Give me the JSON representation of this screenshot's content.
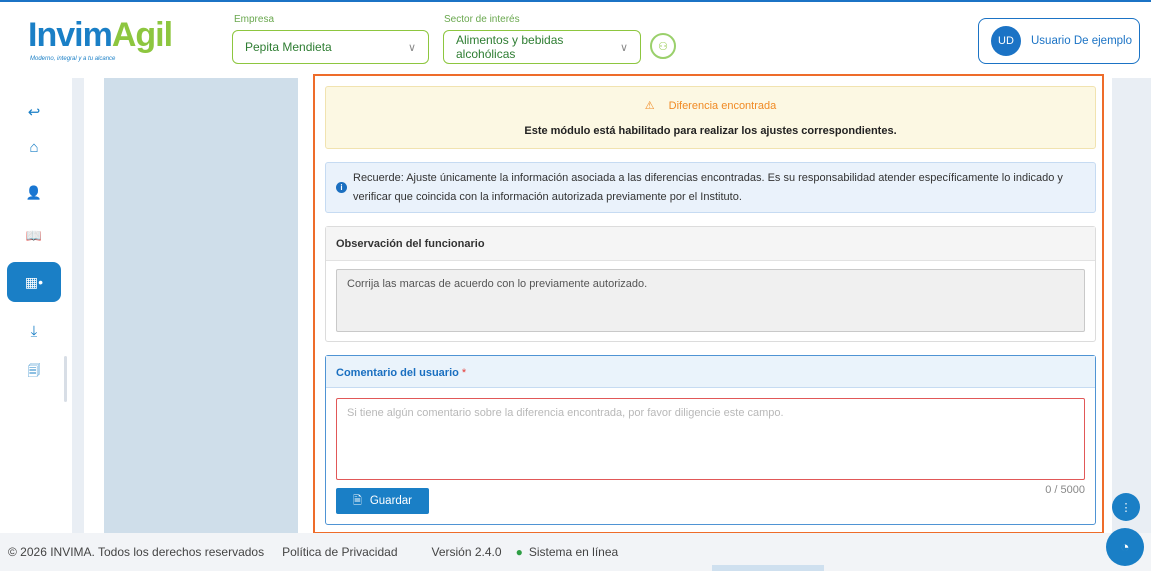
{
  "header": {
    "logo": {
      "text_a": "In",
      "text_b": "vim",
      "text_c": "Agil",
      "tagline": "Moderno, integral y a tu alcance"
    },
    "empresa": {
      "label": "Empresa",
      "value": "Pepita Mendieta"
    },
    "sector": {
      "label": "Sector de interés",
      "value": "Alimentos y bebidas alcohólicas"
    },
    "user": {
      "initials": "UD",
      "name": "Usuario De ejemplo"
    }
  },
  "sidebar": {
    "items": [
      {
        "icon": "back-arrow-icon",
        "glyph": "↩"
      },
      {
        "icon": "home-icon",
        "glyph": "⌂"
      },
      {
        "icon": "user-icon",
        "glyph": "👤"
      },
      {
        "icon": "book-icon",
        "glyph": "📖"
      },
      {
        "icon": "grid-icon",
        "glyph": "▦•"
      },
      {
        "icon": "download-doc-icon",
        "glyph": "⤓"
      },
      {
        "icon": "documents-icon",
        "glyph": "🗐"
      }
    ]
  },
  "alert": {
    "title": "Diferencia encontrada",
    "message": "Este módulo está habilitado para realizar los ajustes correspondientes."
  },
  "info": {
    "text": "Recuerde: Ajuste únicamente la información asociada a las diferencias encontradas. Es su responsabilidad atender específicamente lo indicado y verificar que coincida con la información autorizada previamente por el Instituto."
  },
  "observation": {
    "title": "Observación del funcionario",
    "text": "Corrija las marcas de acuerdo con lo previamente autorizado."
  },
  "comment": {
    "title": "Comentario del usuario",
    "required_mark": "*",
    "placeholder": "Si tiene algún comentario sobre la diferencia encontrada, por favor diligencie este campo.",
    "counter": "0 / 5000",
    "save_label": "Guardar"
  },
  "footer": {
    "copyright": "© 2026 INVIMA. Todos los derechos reservados",
    "privacy": "Política de Privacidad",
    "version": "Versión 2.4.0",
    "status": "Sistema en línea"
  },
  "colors": {
    "primary": "#1a7fc6",
    "brand_green": "#8dc63f",
    "highlight_border": "#ee6c2a",
    "warning_bg": "#fcf8e3",
    "status_ok": "#2e9e44"
  }
}
